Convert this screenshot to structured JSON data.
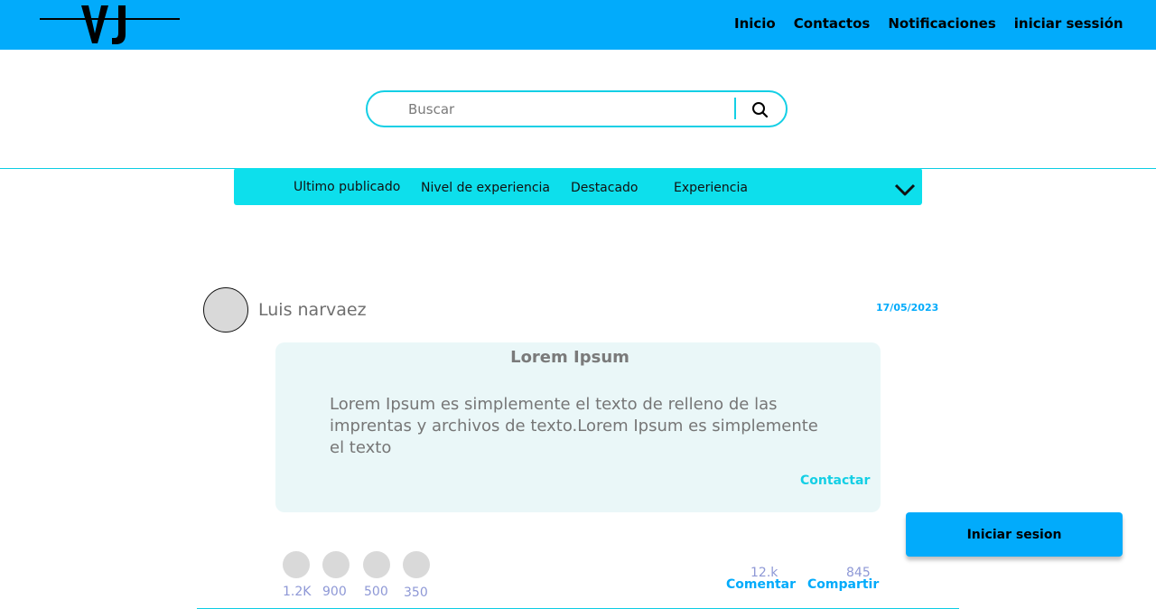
{
  "header": {
    "logo_text": "VJ",
    "nav": [
      {
        "label": "Inicio"
      },
      {
        "label": "Contactos"
      },
      {
        "label": "Notificaciones"
      },
      {
        "label": "iniciar sessión"
      }
    ],
    "background_color": "#02abfb"
  },
  "search": {
    "placeholder": "Buscar",
    "value": "",
    "icon": "search-icon",
    "border_color": "#14cfe5"
  },
  "filters": {
    "tabs": [
      {
        "label": "Ultimo publicado"
      },
      {
        "label": "Nivel de experiencia"
      },
      {
        "label": "Destacado"
      },
      {
        "label": "Experiencia"
      }
    ],
    "dropdown_icon": "chevron-down-icon",
    "background_color": "#0ddfec"
  },
  "post": {
    "author": "Luis narvaez",
    "date": "17/05/2023",
    "title": "Lorem Ipsum",
    "body": "Lorem Ipsum es simplemente el texto de relleno de las imprentas y archivos de texto.Lorem Ipsum es simplemente el texto",
    "contact_label": "Contactar",
    "reactions": [
      {
        "count": "1.2K"
      },
      {
        "count": "900"
      },
      {
        "count": "500"
      },
      {
        "count": "350"
      }
    ],
    "comments": {
      "count": "12.k",
      "label": "Comentar"
    },
    "shares": {
      "count": "845",
      "label": "Compartir"
    }
  },
  "login_button": {
    "label": "Iniciar sesion"
  },
  "colors": {
    "accent": "#02abfb",
    "cyan": "#14cfe5",
    "card_bg": "#eaf7f8",
    "count_text": "#8e98d6"
  }
}
